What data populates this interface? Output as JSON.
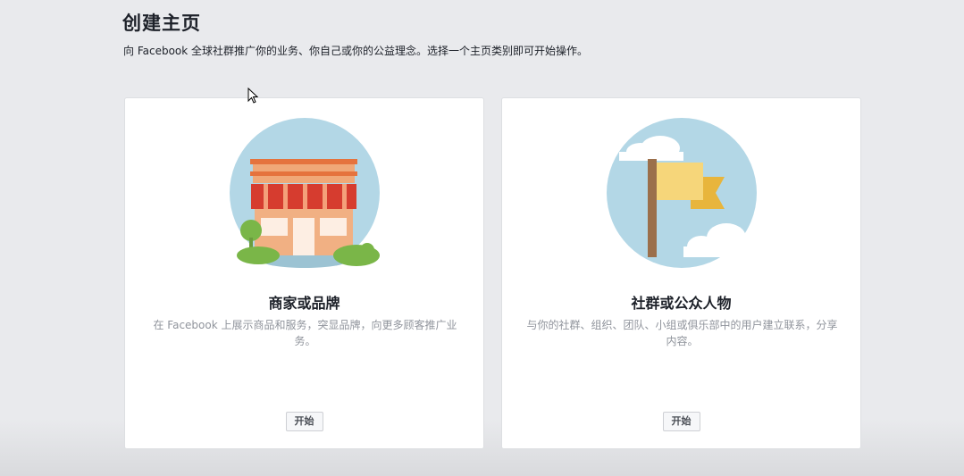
{
  "header": {
    "title": "创建主页",
    "subtitle": "向 Facebook 全球社群推广你的业务、你自己或你的公益理念。选择一个主页类别即可开始操作。"
  },
  "cards": [
    {
      "title": "商家或品牌",
      "description": "在 Facebook 上展示商品和服务，突显品牌，向更多顾客推广业务。",
      "button_label": "开始",
      "icon": "storefront-illustration"
    },
    {
      "title": "社群或公众人物",
      "description": "与你的社群、组织、团队、小组或俱乐部中的用户建立联系，分享内容。",
      "button_label": "开始",
      "icon": "flag-illustration"
    }
  ],
  "colors": {
    "background": "#e9eaed",
    "card": "#ffffff",
    "illustration_circle": "#b3d7e6",
    "awning_red": "#d63c2f",
    "flag_yellow": "#f6d67a"
  }
}
